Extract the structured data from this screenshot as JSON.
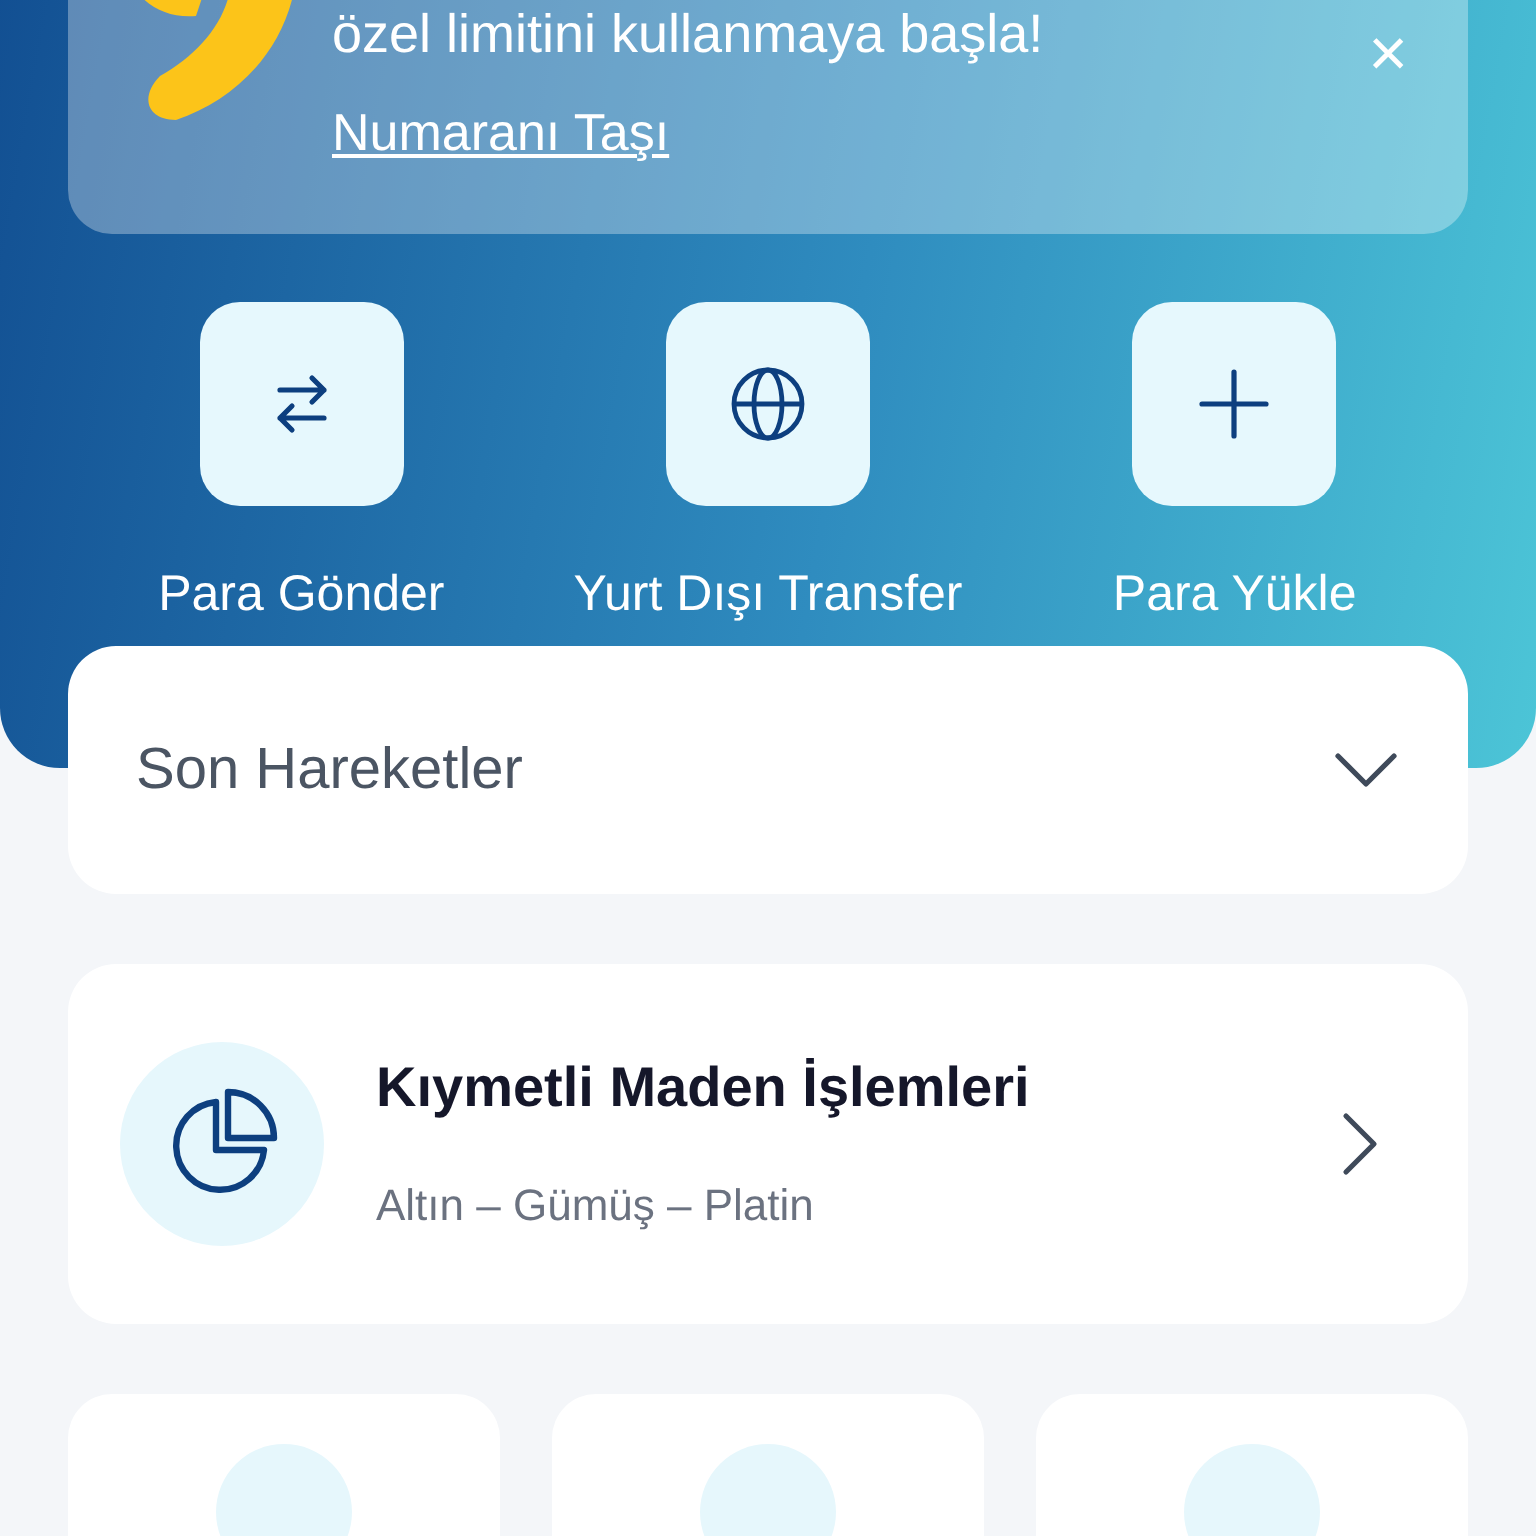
{
  "banner": {
    "text": "özel limitini kullanmaya başla!",
    "link": "Numaranı Taşı",
    "close": "×"
  },
  "actions": [
    {
      "label": "Para Gönder",
      "kind": "swap"
    },
    {
      "label": "Yurt Dışı Transfer",
      "kind": "globe"
    },
    {
      "label": "Para Yükle",
      "kind": "plus"
    }
  ],
  "recent": {
    "title": "Son Hareketler",
    "expanded": false
  },
  "metals": {
    "title": "Kıymetli Maden İşlemleri",
    "subtitle": "Altın – Gümüş – Platin"
  }
}
